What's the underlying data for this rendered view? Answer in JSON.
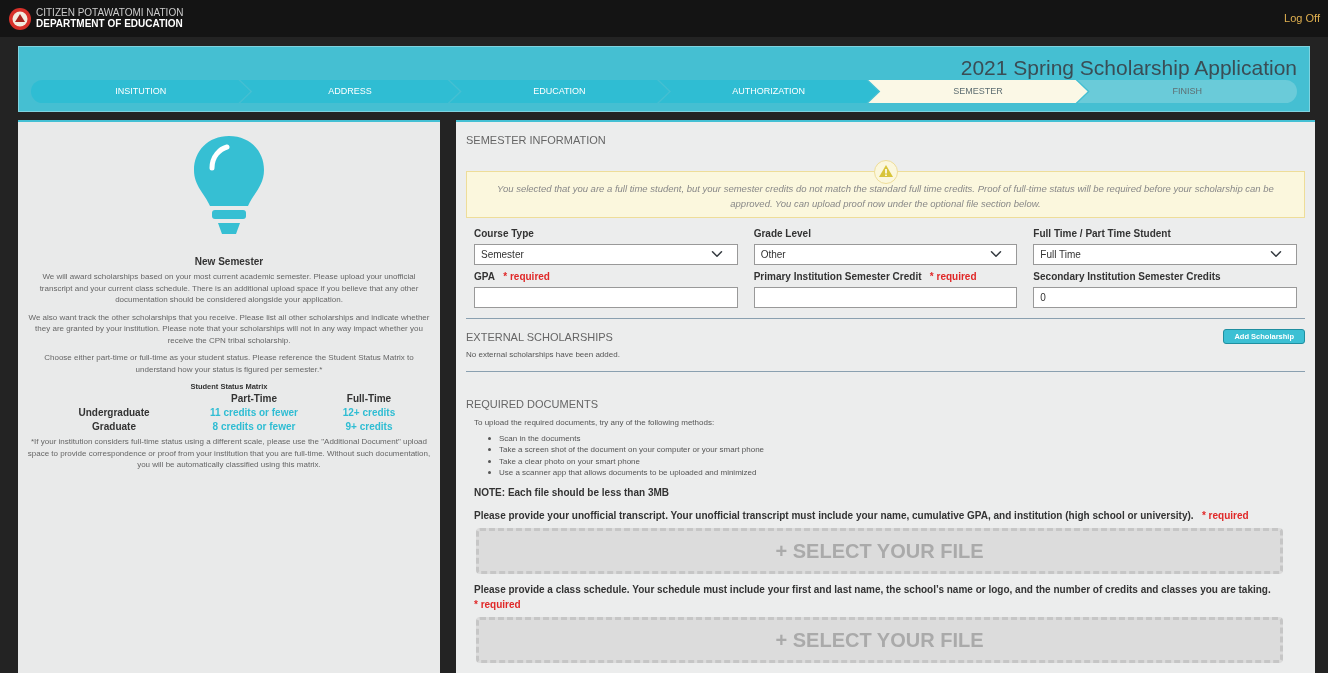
{
  "header": {
    "org_line1": "CITIZEN POTAWATOMI NATION",
    "org_line2": "DEPARTMENT OF EDUCATION",
    "logoff": "Log Off"
  },
  "banner": {
    "title": "2021 Spring Scholarship Application",
    "steps": [
      {
        "label": "INSITUTION",
        "completed": true,
        "selected": false
      },
      {
        "label": "ADDRESS",
        "completed": true,
        "selected": false
      },
      {
        "label": "EDUCATION",
        "completed": true,
        "selected": false
      },
      {
        "label": "AUTHORIZATION",
        "completed": true,
        "selected": false
      },
      {
        "label": "SEMESTER",
        "completed": false,
        "selected": true
      },
      {
        "label": "FINISH",
        "completed": false,
        "selected": false
      }
    ]
  },
  "info_panel": {
    "title": "New Semester",
    "paragraphs": [
      "We will award scholarships based on your most current academic semester. Please upload your unofficial transcript and your current class schedule. There is an additional upload space if you believe that any other documentation should be considered alongside your application.",
      "We also want track the other scholarships that you receive. Please list all other scholarships and indicate whether they are granted by your institution. Please note that your scholarships will not in any way impact whether you receive the CPN tribal scholarship.",
      "Choose either part-time or full-time as your student status. Please reference the Student Status Matrix to understand how your status is figured per semester.*"
    ],
    "matrix": {
      "title": "Student Status Matrix",
      "columns": [
        "Part-Time",
        "Full-Time"
      ],
      "rows": [
        {
          "label": "Undergraduate",
          "cells": [
            "11 credits or fewer",
            "12+ credits"
          ]
        },
        {
          "label": "Graduate",
          "cells": [
            "8 credits or fewer",
            "9+ credits"
          ]
        }
      ]
    },
    "footnote": "*If your institution considers full-time status using a different scale, please use the \"Additional Document\" upload space to provide correspondence or proof from your institution that you are full-time. Without such documentation, you will be automatically classified using this matrix."
  },
  "semester_info": {
    "heading": "SEMESTER INFORMATION",
    "warning": "You selected that you are a full time student, but your semester credits do not match the standard full time credits. Proof of full-time status will be required before your scholarship can be approved. You can upload proof now under the optional file section below.",
    "fields": [
      {
        "kind": "select",
        "label": "Course Type",
        "value": "Semester"
      },
      {
        "kind": "select",
        "label": "Grade Level",
        "value": "Other"
      },
      {
        "kind": "select",
        "label": "Full Time / Part Time Student",
        "value": "Full Time"
      },
      {
        "kind": "input",
        "label": "GPA",
        "required": "* required"
      },
      {
        "kind": "input",
        "label": "Primary Institution Semester Credit",
        "required": "* required"
      },
      {
        "kind": "input",
        "label": "Secondary Institution Semester Credits",
        "value": "0"
      }
    ]
  },
  "external_scholarships": {
    "heading": "EXTERNAL SCHOLARSHIPS",
    "button": "Add Scholarship",
    "empty_text": "No external scholarships have been added."
  },
  "required_documents": {
    "heading": "REQUIRED DOCUMENTS",
    "intro": "To upload the required documents, try any of the following methods:",
    "methods": [
      "Scan in the documents",
      "Take a screen shot of the document on your computer or your smart phone",
      "Take a clear photo on your smart phone",
      "Use a scanner app that allows documents to be uploaded and minimized"
    ],
    "note": "NOTE: Each file should be less than 3MB",
    "uploads": [
      {
        "instruction": "Please provide your unofficial transcript. Your unofficial transcript must include your name, cumulative GPA, and institution (high school or university).",
        "required": "* required",
        "button": "+ SELECT YOUR FILE"
      },
      {
        "instruction": "Please provide a class schedule. Your schedule must include your first and last name, the school’s name or logo, and the number of credits and classes you are taking.",
        "required": "* required",
        "button": "+ SELECT YOUR FILE"
      }
    ]
  }
}
